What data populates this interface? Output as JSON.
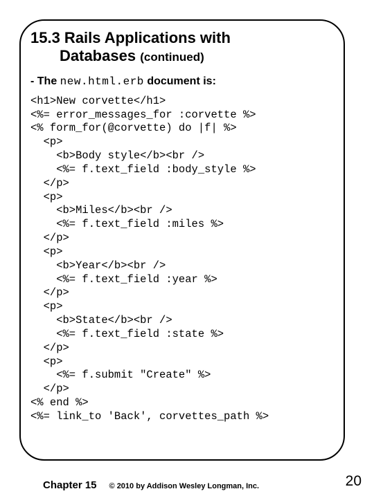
{
  "title": {
    "line1": "15.3 Rails Applications with",
    "line2_main": "Databases",
    "line2_contd": "(continued)"
  },
  "intro": {
    "prefix": " - The ",
    "filename": "new.html.erb",
    "suffix": " document is:"
  },
  "code": "<h1>New corvette</h1>\n<%= error_messages_for :corvette %>\n<% form_for(@corvette) do |f| %>\n  <p>\n    <b>Body style</b><br />\n    <%= f.text_field :body_style %>\n  </p>\n  <p>\n    <b>Miles</b><br />\n    <%= f.text_field :miles %>\n  </p>\n  <p>\n    <b>Year</b><br />\n    <%= f.text_field :year %>\n  </p>\n  <p>\n    <b>State</b><br />\n    <%= f.text_field :state %>\n  </p>\n  <p>\n    <%= f.submit \"Create\" %>\n  </p>\n<% end %>\n<%= link_to 'Back', corvettes_path %>",
  "footer": {
    "chapter": "Chapter 15",
    "copyright": "© 2010 by Addison Wesley Longman, Inc."
  },
  "page_number": "20"
}
